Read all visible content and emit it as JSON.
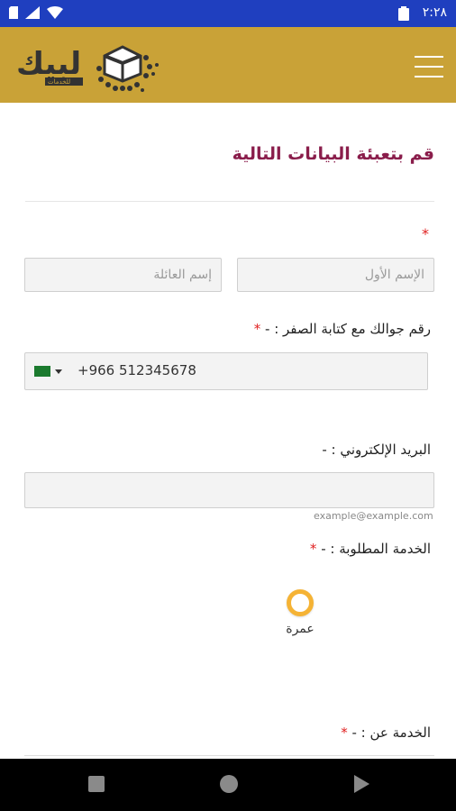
{
  "status_bar": {
    "time": "٢:٢٨",
    "icons": [
      "signal-icon",
      "wifi-icon",
      "battery-icon",
      "sd-card-icon"
    ]
  },
  "header": {
    "logo_text": "لبيك",
    "logo_subtext": "للخدمات",
    "menu_icon": "hamburger-menu-icon",
    "colors": {
      "background": "#c9a237"
    }
  },
  "form": {
    "title": "قم بتعبئة البيانات التالية",
    "name_required_star": "*",
    "first_name_placeholder": "الإسم الأول",
    "last_name_placeholder": "إسم العائلة",
    "phone_label": "رقم جوالك مع كتابة الصفر : -",
    "phone_required_star": "*",
    "phone_value": "+966 512345678",
    "email_label": "البريد الإلكتروني : -",
    "email_hint": "example@example.com",
    "service_label": "الخدمة المطلوبة : -",
    "service_required_star": "*",
    "service_option": "عمرة",
    "service_about_label": "الخدمة عن : -",
    "service_about_required_star": "*"
  },
  "nav_bar": {
    "icons": [
      "back-square-icon",
      "home-circle-icon",
      "recent-triangle-icon"
    ]
  }
}
